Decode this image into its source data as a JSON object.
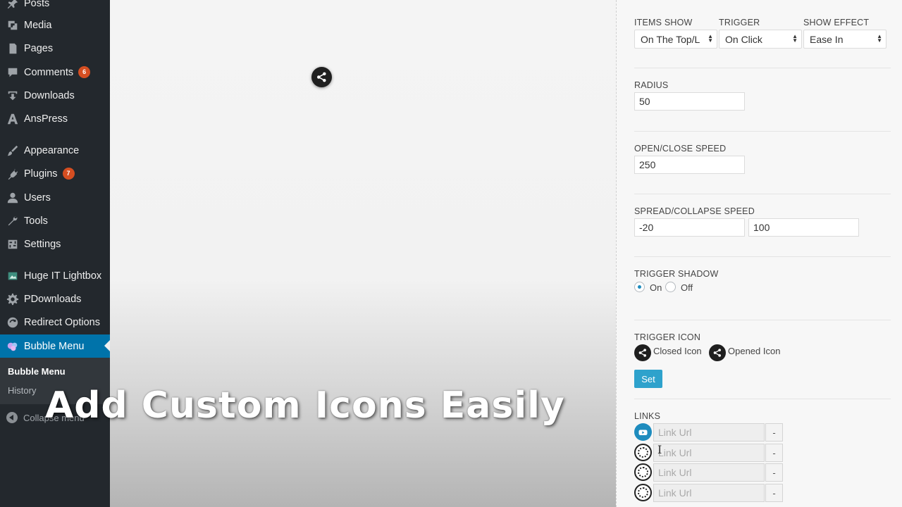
{
  "sidebar": {
    "items": [
      {
        "label": "Posts",
        "icon": "pin-icon"
      },
      {
        "label": "Media",
        "icon": "media-icon"
      },
      {
        "label": "Pages",
        "icon": "pages-icon"
      },
      {
        "label": "Comments",
        "icon": "comments-icon",
        "badge": "6"
      },
      {
        "label": "Downloads",
        "icon": "download-icon"
      },
      {
        "label": "AnsPress",
        "icon": "letter-a-icon"
      },
      {
        "label": "Appearance",
        "icon": "brush-icon"
      },
      {
        "label": "Plugins",
        "icon": "plug-icon",
        "badge": "7"
      },
      {
        "label": "Users",
        "icon": "user-icon"
      },
      {
        "label": "Tools",
        "icon": "wrench-icon"
      },
      {
        "label": "Settings",
        "icon": "settings-icon"
      },
      {
        "label": "Huge IT Lightbox",
        "icon": "lightbox-icon"
      },
      {
        "label": "PDownloads",
        "icon": "gear-icon"
      },
      {
        "label": "Redirect Options",
        "icon": "redirect-icon"
      },
      {
        "label": "Bubble Menu",
        "icon": "bubble-icon",
        "active": true
      }
    ],
    "submenu": [
      {
        "label": "Bubble Menu",
        "current": true
      },
      {
        "label": "History"
      }
    ],
    "collapse_label": "Collapse menu"
  },
  "caption": "Add Custom Icons Easily",
  "settings": {
    "items_show": {
      "label": "ITEMS SHOW",
      "value": "On The Top/L"
    },
    "trigger": {
      "label": "TRIGGER",
      "value": "On Click"
    },
    "show_effect": {
      "label": "SHOW EFFECT",
      "value": "Ease In"
    },
    "radius": {
      "label": "RADIUS",
      "value": "50"
    },
    "open_close_speed": {
      "label": "OPEN/CLOSE SPEED",
      "value": "250"
    },
    "spread_collapse_speed": {
      "label": "SPREAD/COLLAPSE SPEED",
      "value1": "-20",
      "value2": "100"
    },
    "trigger_shadow": {
      "label": "TRIGGER SHADOW",
      "on_label": "On",
      "off_label": "Off",
      "selected": "On"
    },
    "trigger_icon": {
      "label": "TRIGGER ICON",
      "closed_label": "Closed Icon",
      "opened_label": "Opened Icon",
      "set_label": "Set"
    },
    "links": {
      "label": "LINKS",
      "rows": [
        {
          "icon": "youtube-icon",
          "placeholder": "Link Url",
          "remove": "-"
        },
        {
          "icon": "empty-slot-icon",
          "placeholder": "Link Url",
          "remove": "-"
        },
        {
          "icon": "empty-slot-icon",
          "placeholder": "Link Url",
          "remove": "-"
        },
        {
          "icon": "empty-slot-icon",
          "placeholder": "Link Url",
          "remove": "-"
        }
      ]
    }
  },
  "colors": {
    "sidebar_bg": "#23282d",
    "active_bg": "#0073aa",
    "badge": "#d54e21",
    "button": "#2ea2cc"
  }
}
